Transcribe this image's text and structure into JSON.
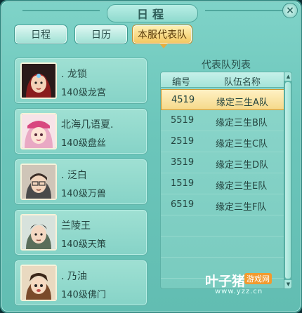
{
  "window": {
    "title": "日程",
    "close_symbol": "×"
  },
  "tabs": [
    {
      "label": "日程",
      "active": false
    },
    {
      "label": "日历",
      "active": false
    },
    {
      "label": "本服代表队",
      "active": true
    }
  ],
  "members": [
    {
      "name": ". 龙锁",
      "level": "140级龙宫",
      "portrait": "member-portrait-icon"
    },
    {
      "name": "北海几语夏.",
      "level": "140级盘丝",
      "portrait": "member-portrait-icon"
    },
    {
      "name": ". 泛白",
      "level": "140级万兽",
      "portrait": "member-portrait-icon"
    },
    {
      "name": "兰陵王",
      "level": "140级天策",
      "portrait": "member-portrait-icon"
    },
    {
      "name": ". 乃油",
      "level": "140级佛门",
      "portrait": "member-portrait-icon"
    }
  ],
  "team_list": {
    "title": "代表队列表",
    "headers": {
      "id": "编号",
      "name": "队伍名称"
    },
    "rows": [
      {
        "id": "4519",
        "name": "缘定三生A队",
        "selected": true
      },
      {
        "id": "5519",
        "name": "缘定三生B队",
        "selected": false
      },
      {
        "id": "2519",
        "name": "缘定三生C队",
        "selected": false
      },
      {
        "id": "3519",
        "name": "缘定三生D队",
        "selected": false
      },
      {
        "id": "1519",
        "name": "缘定三生E队",
        "selected": false
      },
      {
        "id": "6519",
        "name": "缘定三生F队",
        "selected": false
      }
    ]
  },
  "watermark": {
    "main": "叶子猪",
    "tag": "游戏网",
    "url": "www.yzz.cn"
  },
  "colors": {
    "accent_selected": "#f5d98a",
    "panel": "#6cc6bb"
  }
}
